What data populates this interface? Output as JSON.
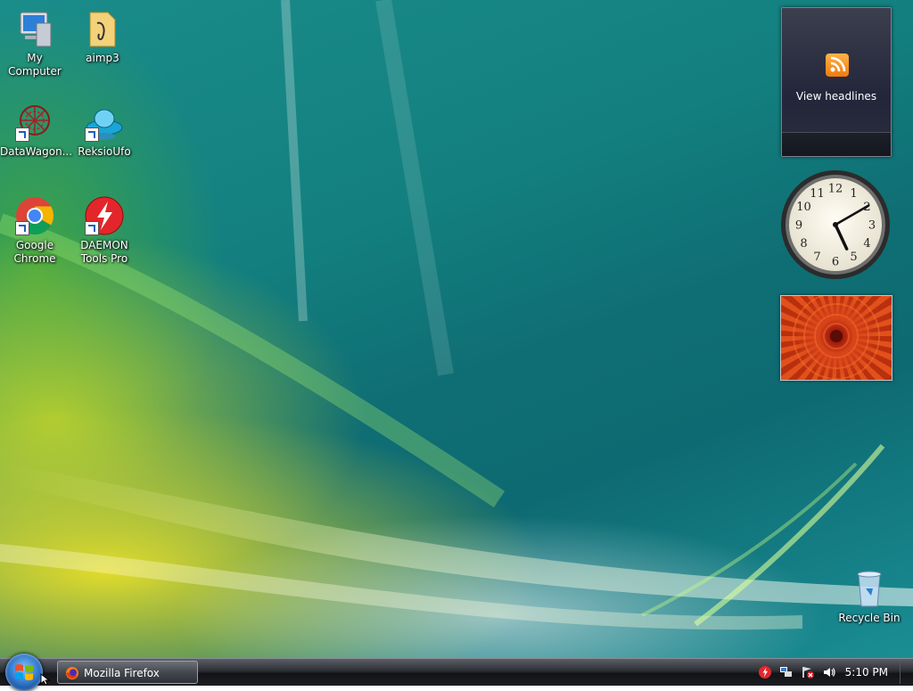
{
  "desktop": {
    "icons": [
      {
        "label": "My Computer",
        "icon": "computer-icon"
      },
      {
        "label": "aimp3",
        "icon": "folder-icon"
      },
      {
        "label": "DataWagon...",
        "icon": "datawagon-icon"
      },
      {
        "label": "ReksioUfo",
        "icon": "ufo-icon"
      },
      {
        "label": "Google Chrome",
        "icon": "chrome-icon"
      },
      {
        "label": "DAEMON Tools Pro",
        "icon": "daemon-tools-icon"
      },
      {
        "label": "Recycle Bin",
        "icon": "recycle-bin-icon"
      }
    ]
  },
  "gadgets": {
    "feed": {
      "label": "View headlines",
      "icon": "rss-icon"
    },
    "clock": {
      "numbers": [
        "12",
        "1",
        "2",
        "3",
        "4",
        "5",
        "6",
        "7",
        "8",
        "9",
        "10",
        "11"
      ],
      "time": "5:10"
    },
    "slideshow": {
      "image": "orange-flower"
    }
  },
  "taskbar": {
    "start_icon": "windows-logo-icon",
    "tasks": [
      {
        "label": "Mozilla Firefox",
        "icon": "firefox-icon"
      }
    ],
    "tray": {
      "icons": [
        "daemon-tray-icon",
        "network-icon",
        "security-alert-icon",
        "volume-icon"
      ],
      "clock": "5:10 PM"
    }
  },
  "colors": {
    "taskbar": "#1c1e22",
    "accent": "#2a6fc4"
  }
}
